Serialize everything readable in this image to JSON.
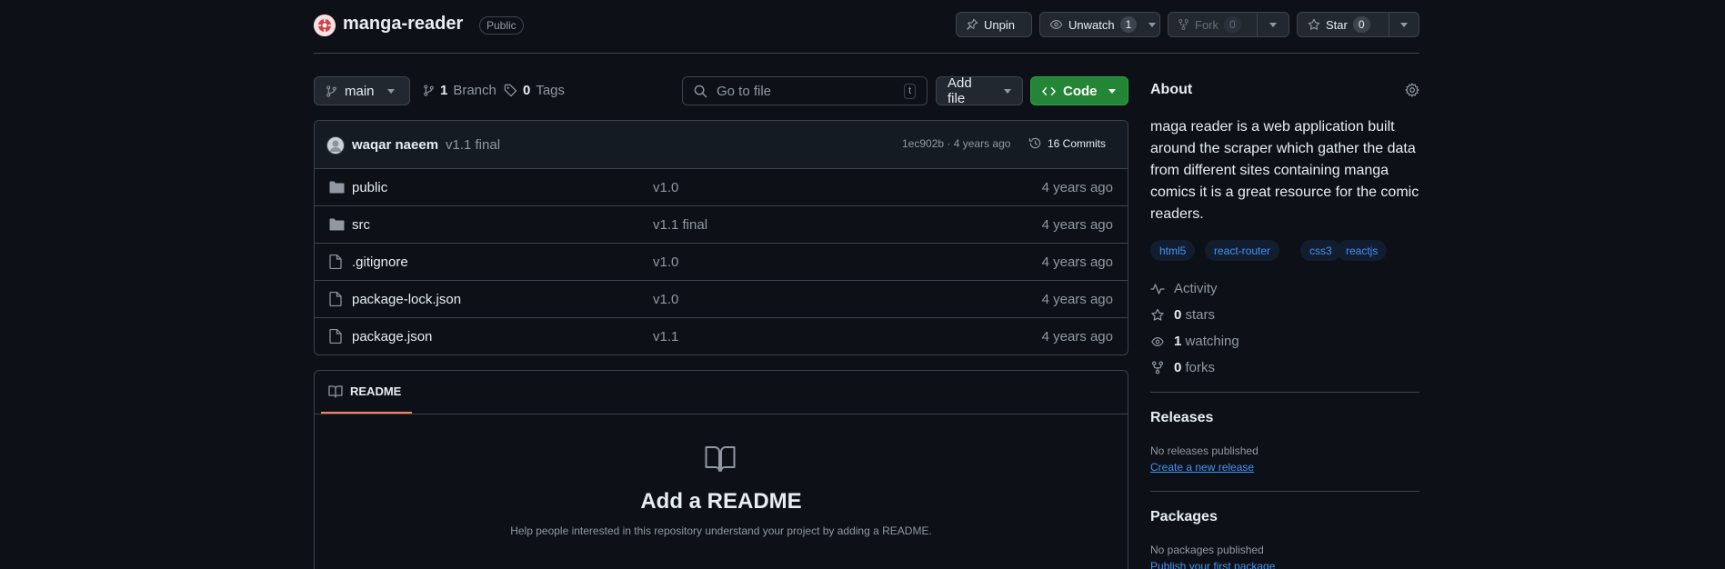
{
  "repo": {
    "name": "manga-reader",
    "visibility": "Public"
  },
  "actions": {
    "unpin": "Unpin",
    "unwatch": "Unwatch",
    "watch_count": "1",
    "fork": "Fork",
    "fork_count": "0",
    "star": "Star",
    "star_count": "0"
  },
  "toolbar": {
    "branch": "main",
    "branch_count": "1",
    "branch_label": "Branch",
    "tag_count": "0",
    "tag_label": "Tags",
    "goto_placeholder": "Go to file",
    "goto_shortcut": "t",
    "add_file": "Add file",
    "code": "Code"
  },
  "commit": {
    "author": "waqar naeem",
    "message": "v1.1 final",
    "hash_age": "1ec902b · 4 years ago",
    "commits": "16 Commits"
  },
  "files": [
    {
      "name": "public",
      "type": "folder",
      "message": "v1.0",
      "age": "4 years ago"
    },
    {
      "name": "src",
      "type": "folder",
      "message": "v1.1 final",
      "age": "4 years ago"
    },
    {
      "name": ".gitignore",
      "type": "file",
      "message": "v1.0",
      "age": "4 years ago"
    },
    {
      "name": "package-lock.json",
      "type": "file",
      "message": "v1.0",
      "age": "4 years ago"
    },
    {
      "name": "package.json",
      "type": "file",
      "message": "v1.1",
      "age": "4 years ago"
    }
  ],
  "readme": {
    "tab": "README",
    "title": "Add a README",
    "subtitle": "Help people interested in this repository understand your project by adding a README."
  },
  "about": {
    "heading": "About",
    "description": "maga reader is a web application built around the scraper which gather the data from different sites containing manga comics it is a great resource for the comic readers.",
    "topics": [
      "html5",
      "react-router",
      "css3",
      "reactjs"
    ],
    "activity": "Activity",
    "stars_count": "0",
    "stars_label": "stars",
    "watching_count": "1",
    "watching_label": "watching",
    "forks_count": "0",
    "forks_label": "forks"
  },
  "releases": {
    "heading": "Releases",
    "empty": "No releases published",
    "link": "Create a new release"
  },
  "packages": {
    "heading": "Packages",
    "empty": "No packages published",
    "link": "Publish your first package"
  },
  "colors": {
    "accent_green": "#238636",
    "link_blue": "#4493f8",
    "tab_underline": "#f78166",
    "background": "#0d1117"
  }
}
